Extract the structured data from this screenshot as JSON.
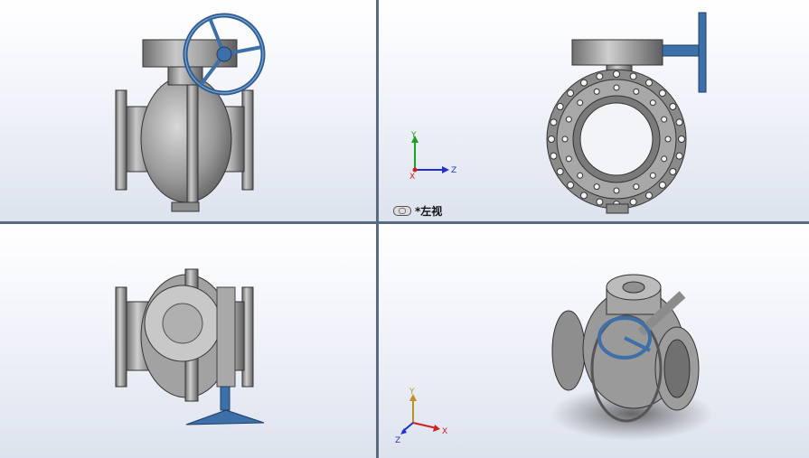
{
  "viewports": {
    "top_left": {
      "name": "front-view"
    },
    "top_right": {
      "name": "left-view",
      "label": "*左视"
    },
    "bottom_left": {
      "name": "top-view"
    },
    "bottom_right": {
      "name": "isometric-view"
    }
  },
  "axes": {
    "top_right": {
      "y": "Y",
      "z": "Z",
      "x": "X"
    },
    "bottom_right": {
      "y": "Y",
      "z": "Z",
      "x": "X"
    }
  },
  "colors": {
    "metal": "#9c9c9c",
    "metal_dark": "#5a5a5a",
    "handwheel": "#3d6fa8",
    "axis_x": "#d02020",
    "axis_y": "#20a020",
    "axis_z": "#2030d0"
  }
}
